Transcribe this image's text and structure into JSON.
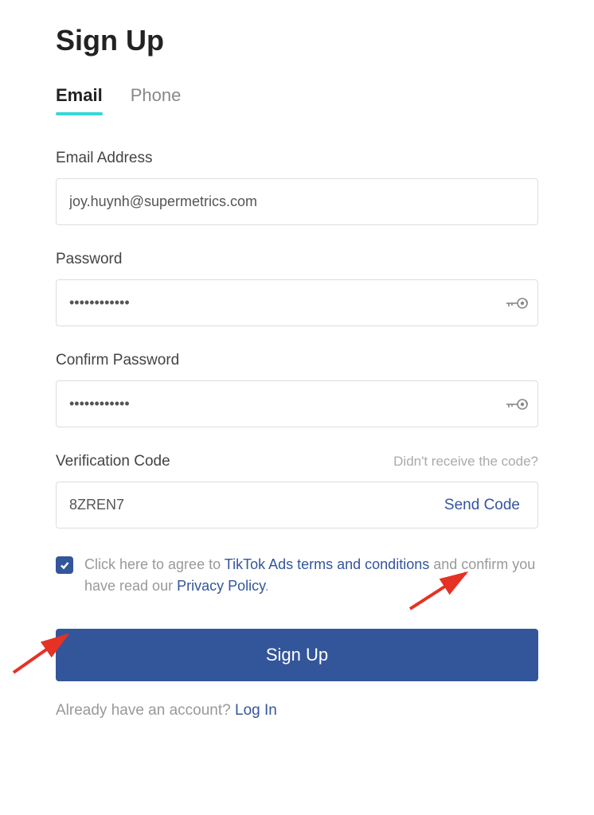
{
  "title": "Sign Up",
  "tabs": {
    "email": "Email",
    "phone": "Phone"
  },
  "fields": {
    "email": {
      "label": "Email Address",
      "value": "joy.huynh@supermetrics.com"
    },
    "password": {
      "label": "Password",
      "value": "••••••••••••"
    },
    "confirm_password": {
      "label": "Confirm Password",
      "value": "••••••••••••"
    },
    "verification": {
      "label": "Verification Code",
      "hint": "Didn't receive the code?",
      "value": "8ZREN7",
      "send_label": "Send Code"
    }
  },
  "agree": {
    "checked": true,
    "prefix": "Click here to agree to ",
    "terms_link": "TikTok Ads terms and conditions",
    "middle": " and confirm you have read our ",
    "policy_link": "Privacy Policy",
    "suffix": "."
  },
  "signup_button": "Sign Up",
  "login": {
    "prefix": "Already have an account? ",
    "link": "Log In"
  }
}
